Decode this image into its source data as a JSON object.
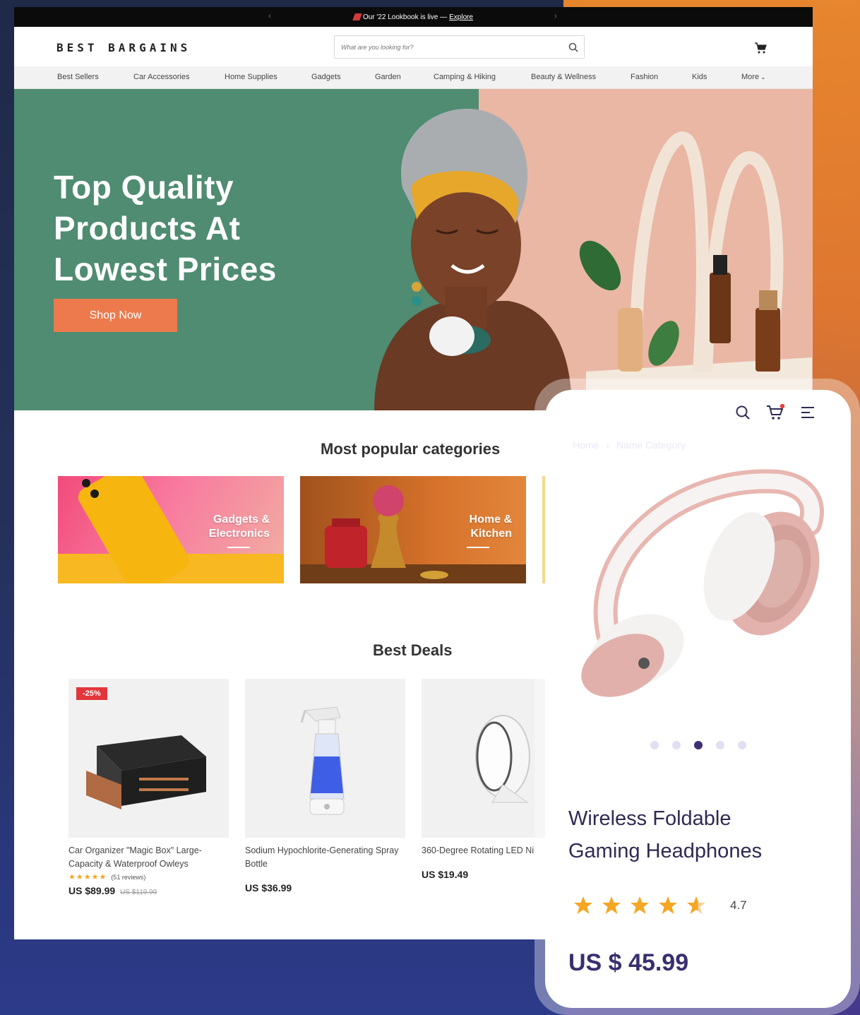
{
  "announcement": {
    "text": "Our '22 Lookbook is live —",
    "link": "Explore"
  },
  "logo": "BEST BARGAINS",
  "search": {
    "placeholder": "What are you looking for?"
  },
  "nav": {
    "items": [
      "Best Sellers",
      "Car Accessories",
      "Home Supplies",
      "Gadgets",
      "Garden",
      "Camping & Hiking",
      "Beauty & Wellness",
      "Fashion",
      "Kids",
      "More"
    ]
  },
  "hero": {
    "title": "Top Quality Products At Lowest Prices",
    "cta": "Shop Now"
  },
  "categories": {
    "title": "Most popular categories",
    "items": [
      {
        "label_line1": "Gadgets &",
        "label_line2": "Electronics"
      },
      {
        "label_line1": "Home &",
        "label_line2": "Kitchen"
      }
    ]
  },
  "deals": {
    "title": "Best Deals",
    "products": [
      {
        "badge": "-25%",
        "name": "Car Organizer \"Magic Box\" Large-Capacity & Waterproof Owleys",
        "reviews": "(51 reviews)",
        "price": "US $89.99",
        "old_price": "US $119.99",
        "rating": 5
      },
      {
        "name": "Sodium Hypochlorite-Generating Spray Bottle",
        "price": "US $36.99"
      },
      {
        "name": "360-Degree Rotating LED Ni",
        "price": "US $19.49"
      }
    ]
  },
  "mobile": {
    "breadcrumb": [
      "Home",
      "Name Category"
    ],
    "carousel": {
      "total": 5,
      "active": 3
    },
    "product_title": "Wireless Foldable Gaming Headphones",
    "rating": "4.7",
    "rating_value": 4.7,
    "price": "US $ 45.99"
  },
  "colors": {
    "hero_green": "#4f8c72",
    "cta": "#ec7a4d",
    "mobile_accent": "#3a2e70",
    "badge": "#e2363a"
  }
}
